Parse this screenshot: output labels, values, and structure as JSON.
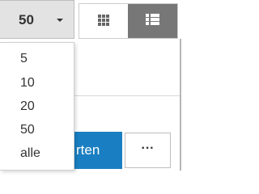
{
  "page_size_select": {
    "selected_value": "50",
    "options": [
      "5",
      "10",
      "20",
      "50",
      "alle"
    ]
  },
  "view_toggle": {
    "grid_icon": "grid-icon",
    "list_icon": "list-icon",
    "active": "list"
  },
  "actions": {
    "primary_label_visible": "rten",
    "more_label": "···"
  },
  "colors": {
    "primary": "#1a7fc2",
    "active_toggle": "#777777",
    "select_bg": "#e3e3e3"
  }
}
